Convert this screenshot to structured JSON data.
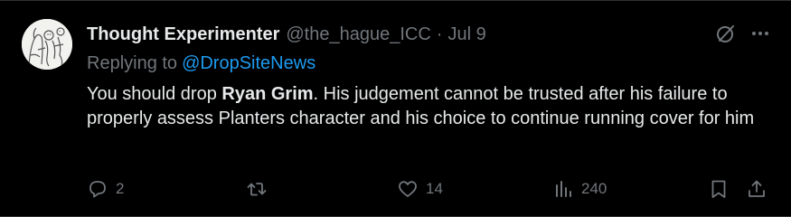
{
  "tweet": {
    "display_name": "Thought Experimenter",
    "handle": "@the_hague_ICC",
    "separator": "·",
    "date": "Jul 9",
    "replying_prefix": "Replying to",
    "replying_to": "@DropSiteNews",
    "text_before": "You should drop ",
    "text_bold": "Ryan Grim",
    "text_after": ". His judgement cannot be trusted after his failure to properly assess Planters character and his choice to continue running cover for him"
  },
  "actions": {
    "reply_count": "2",
    "like_count": "14",
    "views_count": "240"
  },
  "icons": {
    "grok": "slashed-circle-icon",
    "more": "more-horizontal-icon",
    "reply": "speech-bubble-icon",
    "retweet": "retweet-arrows-icon",
    "like": "heart-icon",
    "views": "bar-chart-icon",
    "bookmark": "bookmark-icon",
    "share": "share-upload-icon"
  },
  "colors": {
    "background": "#000000",
    "text_primary": "#e7e9ea",
    "text_secondary": "#71767b",
    "link": "#1d9bf0"
  }
}
